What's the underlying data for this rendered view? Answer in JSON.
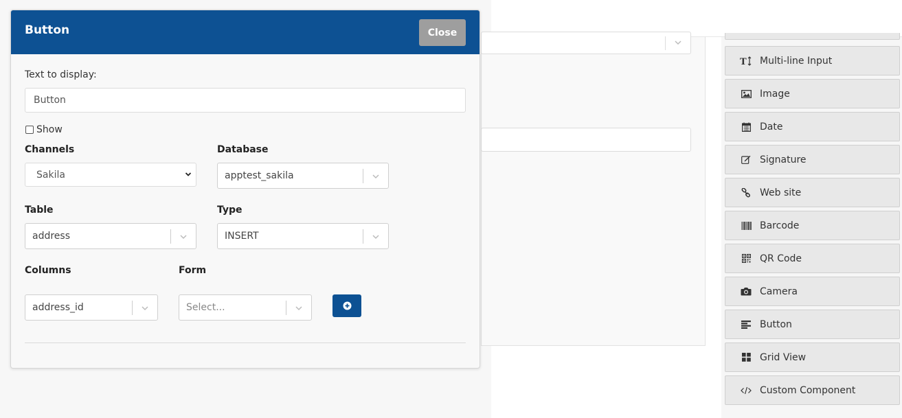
{
  "modal": {
    "title": "Button",
    "close_label": "Close",
    "text_label": "Text to display:",
    "text_value": "Button",
    "show_label": "Show",
    "show_checked": false,
    "channels_label": "Channels",
    "channels_value": "Sakila",
    "database_label": "Database",
    "database_value": "apptest_sakila",
    "table_label": "Table",
    "table_value": "address",
    "type_label": "Type",
    "type_value": "INSERT",
    "columns_label": "Columns",
    "columns_value": "address_id",
    "form_label": "Form",
    "form_placeholder": "Select..."
  },
  "palette": {
    "items": [
      {
        "label": "Multi-line Input",
        "icon": "text-height-icon"
      },
      {
        "label": "Image",
        "icon": "image-icon"
      },
      {
        "label": "Date",
        "icon": "calendar-icon"
      },
      {
        "label": "Signature",
        "icon": "edit-icon"
      },
      {
        "label": "Web site",
        "icon": "link-icon"
      },
      {
        "label": "Barcode",
        "icon": "barcode-icon"
      },
      {
        "label": "QR Code",
        "icon": "qrcode-icon"
      },
      {
        "label": "Camera",
        "icon": "camera-icon"
      },
      {
        "label": "Button",
        "icon": "button-icon"
      },
      {
        "label": "Grid View",
        "icon": "grid-icon"
      },
      {
        "label": "Custom Component",
        "icon": "code-icon"
      }
    ]
  },
  "colors": {
    "header": "#0d5193",
    "close_button": "#9e9e9e",
    "add_button": "#0d5193"
  }
}
